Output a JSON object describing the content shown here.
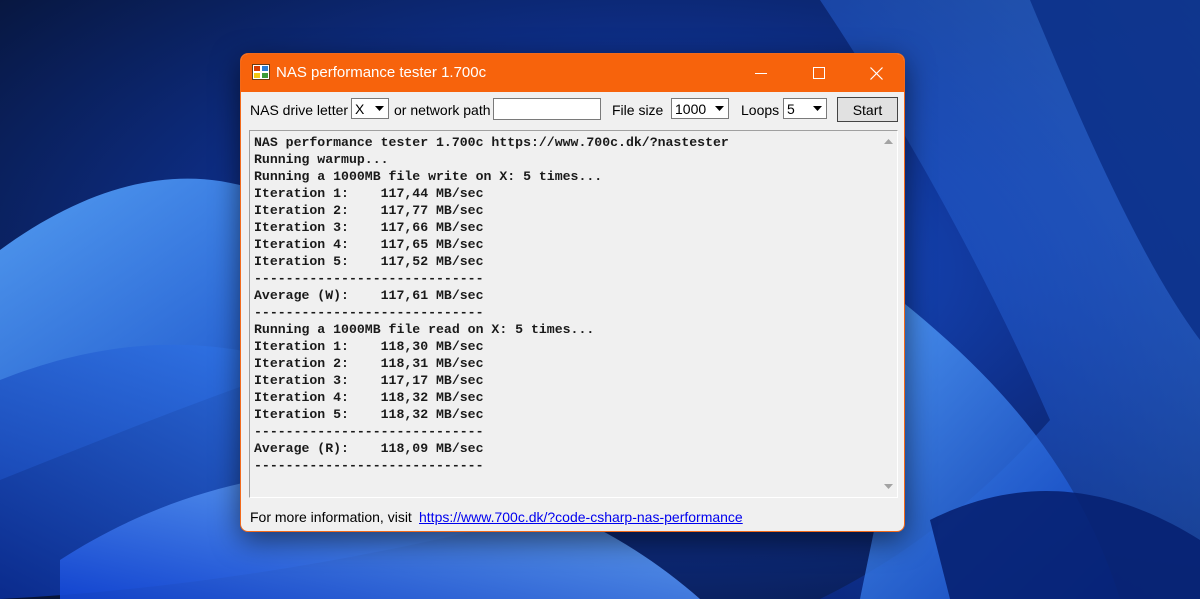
{
  "window": {
    "title": "NAS performance tester 1.700c",
    "accent_color": "#f7630c",
    "app_icon": "window-app-icon"
  },
  "toolbar": {
    "drive_letter_label": "NAS drive letter",
    "drive_letter_value": "X",
    "network_path_label": "or network path",
    "network_path_value": "",
    "file_size_label": "File size",
    "file_size_value": "1000",
    "loops_label": "Loops",
    "loops_value": "5",
    "start_label": "Start"
  },
  "log": {
    "lines": [
      "NAS performance tester 1.700c https://www.700c.dk/?nastester",
      "Running warmup...",
      "Running a 1000MB file write on X: 5 times...",
      "Iteration 1:    117,44 MB/sec",
      "Iteration 2:    117,77 MB/sec",
      "Iteration 3:    117,66 MB/sec",
      "Iteration 4:    117,65 MB/sec",
      "Iteration 5:    117,52 MB/sec",
      "-----------------------------",
      "Average (W):    117,61 MB/sec",
      "-----------------------------",
      "Running a 1000MB file read on X: 5 times...",
      "Iteration 1:    118,30 MB/sec",
      "Iteration 2:    118,31 MB/sec",
      "Iteration 3:    117,17 MB/sec",
      "Iteration 4:    118,32 MB/sec",
      "Iteration 5:    118,32 MB/sec",
      "-----------------------------",
      "Average (R):    118,09 MB/sec",
      "-----------------------------"
    ]
  },
  "footer": {
    "info_text": "For more information, visit",
    "link_text": "https://www.700c.dk/?code-csharp-nas-performance"
  },
  "icons": {
    "minimize": "minimize-icon",
    "maximize": "maximize-icon",
    "close": "close-icon",
    "dropdown": "chevron-down-icon",
    "scroll_up": "scroll-up-icon",
    "scroll_down": "scroll-down-icon"
  }
}
